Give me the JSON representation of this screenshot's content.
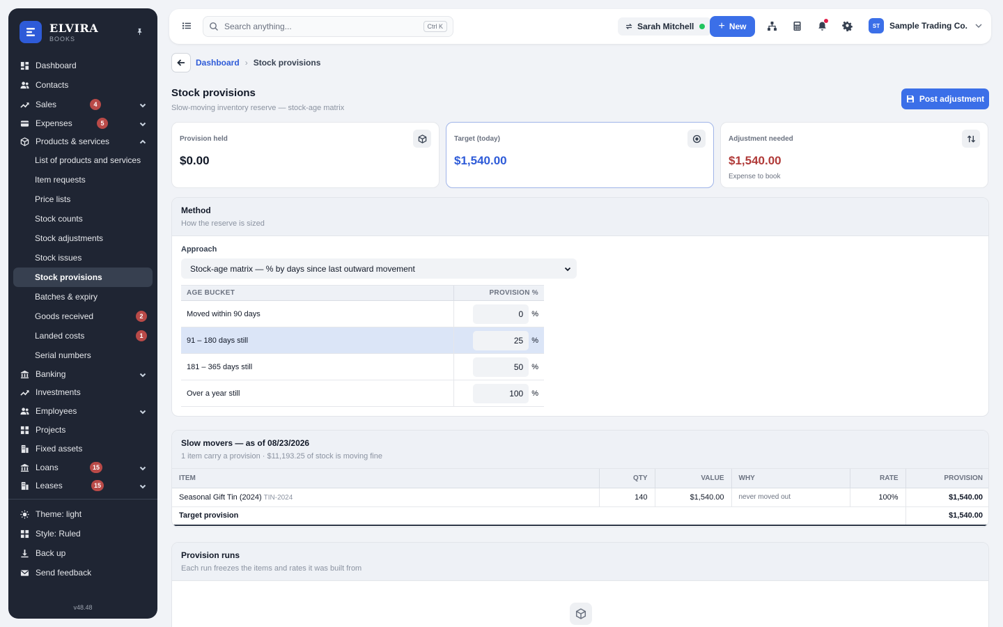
{
  "app": {
    "name": "ELVIRA",
    "subtitle": "BOOKS",
    "version": "v48.48"
  },
  "sidebar": {
    "items": [
      {
        "label": "Dashboard",
        "icon": "dashboard-icon"
      },
      {
        "label": "Contacts",
        "icon": "contacts-icon"
      },
      {
        "label": "Sales",
        "icon": "trend-icon",
        "badge": "4",
        "expandable": true
      },
      {
        "label": "Expenses",
        "icon": "card-icon",
        "badge": "5",
        "expandable": true
      },
      {
        "label": "Products & services",
        "icon": "box-icon",
        "expanded": true
      },
      {
        "label": "Banking",
        "icon": "bank-icon",
        "expandable": true
      },
      {
        "label": "Investments",
        "icon": "trend-icon"
      },
      {
        "label": "Employees",
        "icon": "contacts-icon",
        "expandable": true
      },
      {
        "label": "Projects",
        "icon": "dashboard-icon"
      },
      {
        "label": "Fixed assets",
        "icon": "building-icon"
      },
      {
        "label": "Loans",
        "icon": "bank-icon",
        "badge": "15",
        "expandable": true
      },
      {
        "label": "Leases",
        "icon": "building-icon",
        "badge": "15",
        "expandable": true
      }
    ],
    "products_sub": [
      {
        "label": "List of products and services"
      },
      {
        "label": "Item requests"
      },
      {
        "label": "Price lists"
      },
      {
        "label": "Stock counts"
      },
      {
        "label": "Stock adjustments"
      },
      {
        "label": "Stock issues"
      },
      {
        "label": "Stock provisions",
        "active": true
      },
      {
        "label": "Batches & expiry"
      },
      {
        "label": "Goods received",
        "badge": "2"
      },
      {
        "label": "Landed costs",
        "badge": "1"
      },
      {
        "label": "Serial numbers"
      }
    ],
    "bottom": [
      {
        "label": "Theme: light",
        "icon": "sun-icon"
      },
      {
        "label": "Style: Ruled",
        "icon": "grid-icon"
      },
      {
        "label": "Back up",
        "icon": "download-icon"
      },
      {
        "label": "Send feedback",
        "icon": "mail-icon"
      }
    ]
  },
  "topbar": {
    "search_placeholder": "Search anything...",
    "search_shortcut": "Ctrl K",
    "user": "Sarah Mitchell",
    "new_label": "New",
    "company_initials": "ST",
    "company": "Sample Trading Co."
  },
  "breadcrumb": {
    "parent": "Dashboard",
    "current": "Stock provisions"
  },
  "page": {
    "title": "Stock provisions",
    "subtitle": "Slow-moving inventory reserve — stock-age matrix",
    "post_button": "Post adjustment"
  },
  "kpis": [
    {
      "label": "Provision held",
      "value": "$0.00",
      "note": "",
      "color": "#111827",
      "icon": "box-icon"
    },
    {
      "label": "Target (today)",
      "value": "$1,540.00",
      "note": "",
      "color": "#2e5bd8",
      "icon": "target-icon"
    },
    {
      "label": "Adjustment needed",
      "value": "$1,540.00",
      "note": "Expense to book",
      "color": "#b03a38",
      "icon": "swap-icon"
    }
  ],
  "method": {
    "title": "Method",
    "subtitle": "How the reserve is sized",
    "approach_label": "Approach",
    "approach_value": "Stock-age matrix — % by days since last outward movement",
    "col_bucket": "AGE BUCKET",
    "col_pct": "PROVISION %",
    "rows": [
      {
        "bucket": "Moved within 90 days",
        "pct": "0"
      },
      {
        "bucket": "91 – 180 days still",
        "pct": "25"
      },
      {
        "bucket": "181 – 365 days still",
        "pct": "50"
      },
      {
        "bucket": "Over a year still",
        "pct": "100"
      }
    ],
    "pct_sign": "%"
  },
  "slow_movers": {
    "title": "Slow movers — as of 08/23/2026",
    "subtitle": "1 item carry a provision · $11,193.25 of stock is moving fine",
    "columns": {
      "item": "ITEM",
      "qty": "QTY",
      "value": "VALUE",
      "why": "WHY",
      "rate": "RATE",
      "provision": "PROVISION"
    },
    "rows": [
      {
        "item": "Seasonal Gift Tin (2024)",
        "sku": "TIN-2024",
        "qty": "140",
        "value": "$1,540.00",
        "why": "never moved out",
        "rate": "100%",
        "provision": "$1,540.00"
      }
    ],
    "total_label": "Target provision",
    "total_value": "$1,540.00"
  },
  "runs": {
    "title": "Provision runs",
    "subtitle": "Each run freezes the items and rates it was built from"
  }
}
